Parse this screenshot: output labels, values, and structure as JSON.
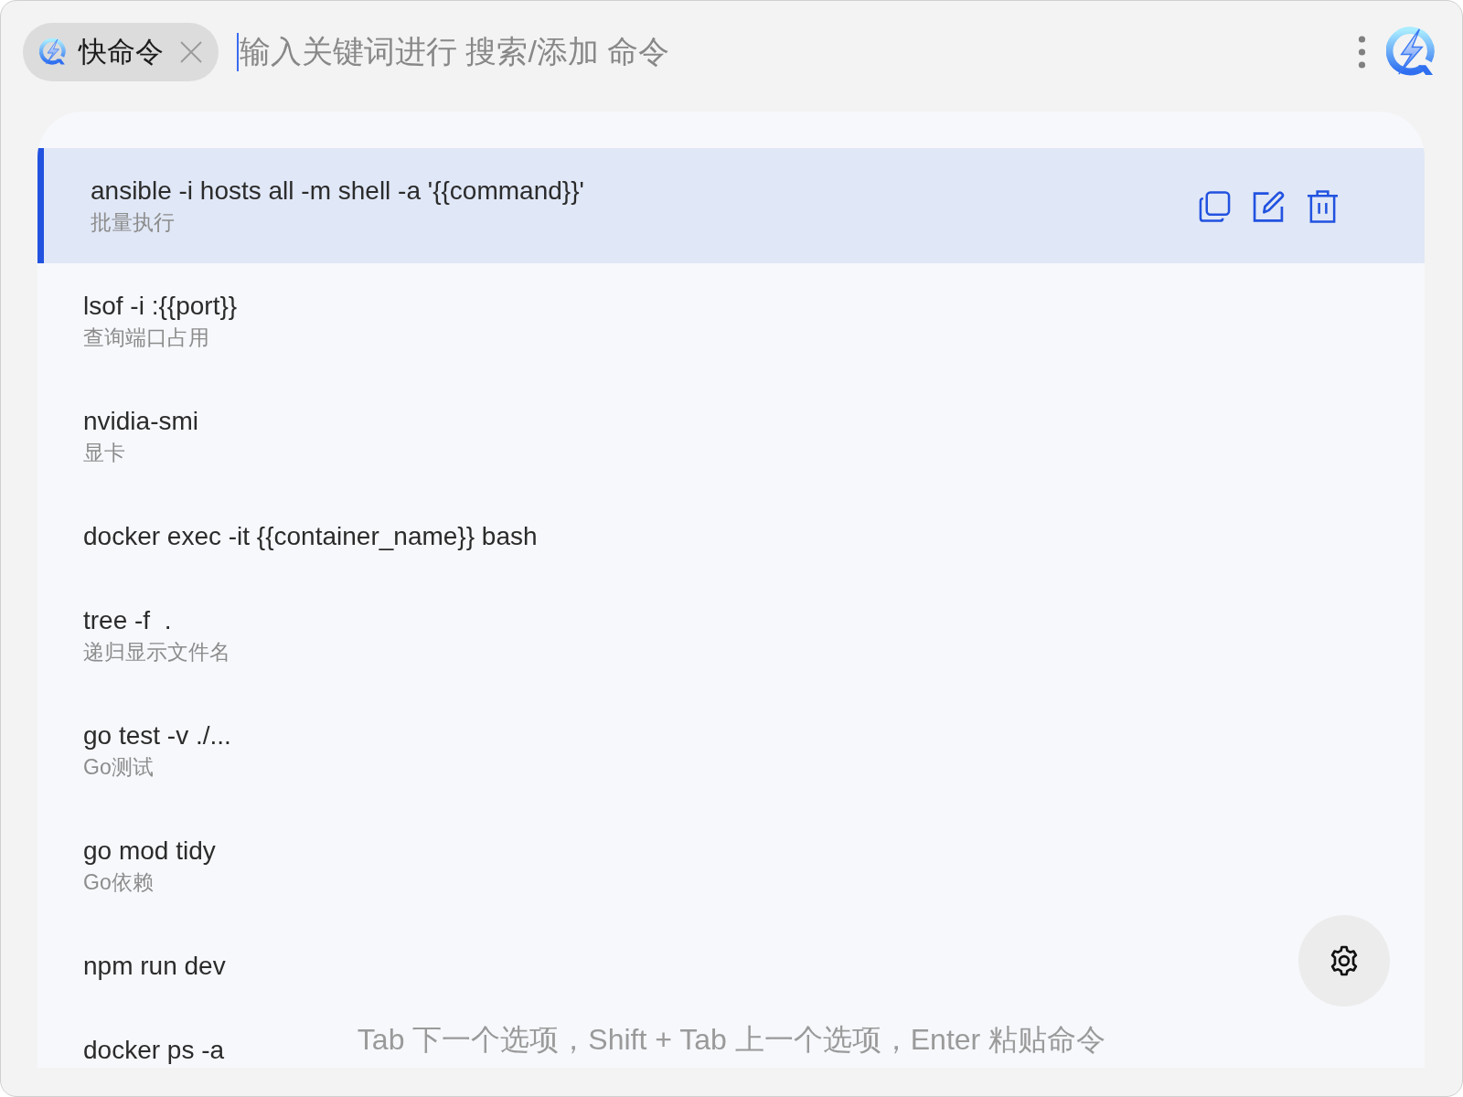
{
  "search": {
    "tag": {
      "label": "快命令"
    },
    "placeholder": "输入关键词进行 搜索/添加 命令"
  },
  "commands": [
    {
      "command": "ansible -i hosts all -m shell -a '{{command}}'",
      "description": "批量执行",
      "selected": true
    },
    {
      "command": "lsof -i :{{port}}",
      "description": "查询端口占用",
      "selected": false
    },
    {
      "command": "nvidia-smi",
      "description": "显卡",
      "selected": false
    },
    {
      "command": "docker exec -it {{container_name}} bash",
      "selected": false
    },
    {
      "command": "tree -f  .",
      "description": "递归显示文件名",
      "selected": false
    },
    {
      "command": "go test -v ./...",
      "description": "Go测试",
      "selected": false
    },
    {
      "command": "go mod tidy",
      "description": "Go依赖",
      "selected": false
    },
    {
      "command": "npm run dev",
      "selected": false
    },
    {
      "command": "docker ps -a",
      "selected": false
    }
  ],
  "hint": "Tab 下一个选项，Shift + Tab 上一个选项，Enter 粘贴命令"
}
